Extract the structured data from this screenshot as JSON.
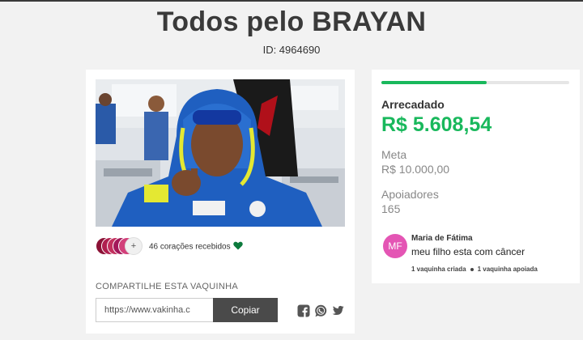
{
  "campaign": {
    "title": "Todos pelo BRAYAN",
    "id_text": "ID: 4964690"
  },
  "hearts": {
    "plus": "+",
    "text": "46 corações recebidos",
    "avatar_colors": [
      "#8b1236",
      "#b0204f",
      "#c2305e",
      "#a3185a",
      "#d2407a"
    ],
    "heart_color": "#0d7a3d"
  },
  "share": {
    "label": "COMPARTILHE ESTA VAQUINHA",
    "input_value": "https://www.vakinha.c",
    "copy_label": "Copiar",
    "icons": [
      "facebook-icon",
      "whatsapp-icon",
      "twitter-icon"
    ]
  },
  "stats": {
    "progress_fraction": 0.56,
    "raised_label": "Arrecadado",
    "raised_value": "R$ 5.608,54",
    "goal_label": "Meta",
    "goal_value": "R$ 10.000,00",
    "supporters_label": "Apoiadores",
    "supporters_value": "165",
    "accent_color": "#19b85c"
  },
  "organizer": {
    "initials": "MF",
    "name": "Maria de Fátima",
    "message": "meu filho esta com câncer",
    "created": "1 vaquinha criada",
    "supported": "1 vaquinha apoiada",
    "avatar_color": "#e455b4"
  }
}
